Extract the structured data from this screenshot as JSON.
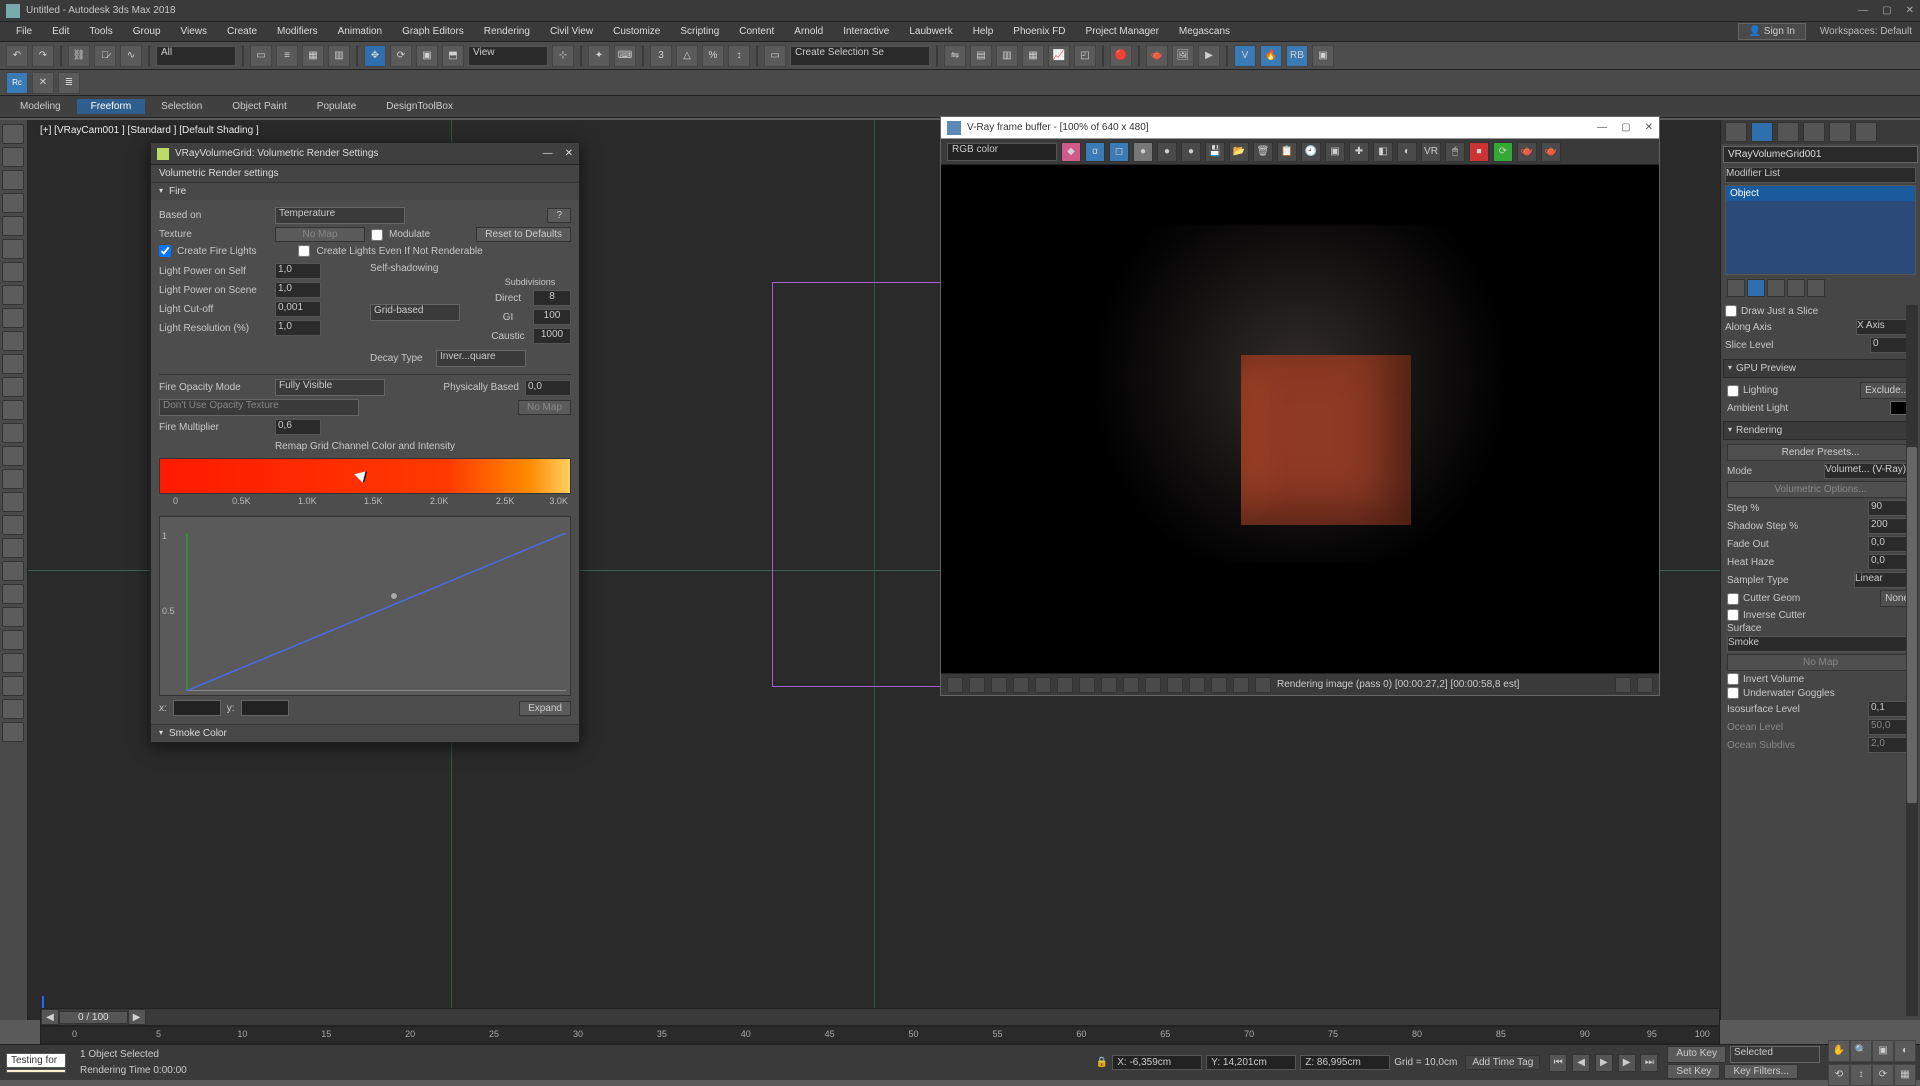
{
  "app": {
    "title": "Untitled - Autodesk 3ds Max 2018"
  },
  "menu": [
    "File",
    "Edit",
    "Tools",
    "Group",
    "Views",
    "Create",
    "Modifiers",
    "Animation",
    "Graph Editors",
    "Rendering",
    "Civil View",
    "Customize",
    "Scripting",
    "Content",
    "Arnold",
    "Interactive",
    "Laubwerk",
    "Help",
    "Phoenix FD",
    "Project Manager",
    "Megascans"
  ],
  "signin": "Sign In",
  "workspace_label": "Workspaces: Default",
  "toolbar_dropdowns": {
    "all_filter": "All",
    "view_mode": "View",
    "create_sel_set": "Create Selection Se"
  },
  "ribbon_tabs": [
    "Modeling",
    "Freeform",
    "Selection",
    "Object Paint",
    "Populate",
    "DesignToolBox"
  ],
  "viewport_label": "[+] [VRayCam001 ] [Standard ] [Default Shading ]",
  "command_panel": {
    "object_name": "VRayVolumeGrid001",
    "modifier_label": "Modifier List",
    "stack_item": "Object",
    "slice": {
      "draw_label": "Draw Just a Slice",
      "axis_label": "Along Axis",
      "axis_value": "X Axis",
      "level_label": "Slice Level",
      "level_value": "0"
    },
    "preview": {
      "header": "GPU Preview",
      "lighting_label": "Lighting",
      "exclude_btn": "Exclude...",
      "ambient_label": "Ambient Light"
    },
    "rendering": {
      "header": "Rendering",
      "presets_btn": "Render Presets...",
      "mode_label": "Mode",
      "mode_value": "Volumet... (V-Ray)",
      "vol_opts_btn": "Volumetric Options...",
      "step_label": "Step %",
      "step_value": "90",
      "shadow_label": "Shadow Step %",
      "shadow_value": "200",
      "fade_label": "Fade Out",
      "fade_value": "0,0",
      "haze_label": "Heat Haze",
      "haze_value": "0,0",
      "sampler_label": "Sampler Type",
      "sampler_value": "Linear",
      "cutter_label": "Cutter Geom",
      "cutter_value": "None",
      "inverse_cutter": "Inverse Cutter",
      "surface_label": "Surface",
      "surface_value": "Smoke",
      "nomap": "No Map",
      "invert_vol": "Invert Volume",
      "goggles": "Underwater Goggles",
      "iso_label": "Isosurface Level",
      "iso_value": "0,1",
      "ocean_level_label": "Ocean Level",
      "ocean_level_value": "50,0",
      "ocean_subdiv_label": "Ocean Subdivs",
      "ocean_subdiv_value": "2,0"
    }
  },
  "vol_dialog": {
    "title": "VRayVolumeGrid: Volumetric Render Settings",
    "subtitle": "Volumetric Render settings",
    "fire_header": "Fire",
    "based_on_label": "Based on",
    "based_on_value": "Temperature",
    "help_btn": "?",
    "texture_label": "Texture",
    "texture_btn": "No Map",
    "modulate_label": "Modulate",
    "reset_btn": "Reset to Defaults",
    "create_fire_lights": "Create Fire Lights",
    "create_lights_nonrender": "Create Lights Even If Not Renderable",
    "lp_self_label": "Light Power on Self",
    "lp_self_value": "1,0",
    "lp_scene_label": "Light Power on Scene",
    "lp_scene_value": "1,0",
    "light_cut_label": "Light Cut-off",
    "light_cut_value": "0,001",
    "light_res_label": "Light Resolution (%)",
    "light_res_value": "1,0",
    "self_shadow_label": "Self-shadowing",
    "self_shadow_value": "Grid-based",
    "decay_label": "Decay Type",
    "decay_value": "Inver...quare",
    "subdiv_header": "Subdivisions",
    "direct_label": "Direct",
    "direct_value": "8",
    "gi_label": "GI",
    "gi_value": "100",
    "caustic_label": "Caustic",
    "caustic_value": "1000",
    "opacity_mode_label": "Fire Opacity Mode",
    "opacity_mode_value": "Fully Visible",
    "phys_based_label": "Physically Based",
    "phys_based_value": "0,0",
    "use_opacity_tex": "Don't Use Opacity Texture",
    "nomap2": "No Map",
    "fire_mult_label": "Fire Multiplier",
    "fire_mult_value": "0,6",
    "remap_header": "Remap Grid Channel Color and Intensity",
    "grad_ticks": [
      "0",
      "0.5K",
      "1.0K",
      "1.5K",
      "2.0K",
      "2.5K",
      "3.0K"
    ],
    "y_ticks": [
      "1",
      "0.5"
    ],
    "x_label": "x:",
    "y_label": "y:",
    "expand_btn": "Expand",
    "smoke_header": "Smoke Color"
  },
  "vfb": {
    "title": "V-Ray frame buffer - [100% of 640 x 480]",
    "channel": "RGB color",
    "status_text": "Rendering image (pass 0) [00:00:27,2] [00:00:58,8 est]"
  },
  "timeline": {
    "frame_indicator": "0 / 100",
    "ticks": [
      0,
      5,
      10,
      15,
      20,
      25,
      30,
      35,
      40,
      45,
      50,
      55,
      60,
      65,
      70,
      75,
      80,
      85,
      90,
      95,
      100
    ]
  },
  "status": {
    "sel_info": "1 Object Selected",
    "render_time": "Rendering Time 0:00:00",
    "testing": "Testing for ",
    "coords": {
      "x": "X: -6,359cm",
      "y": "Y: 14,201cm",
      "z": "Z: 86,995cm",
      "grid": "Grid = 10,0cm"
    },
    "autokey": "Auto Key",
    "setkey": "Set Key",
    "selected": "Selected",
    "keyfilters": "Key Filters...",
    "add_time_tag": "Add Time Tag"
  },
  "chart_data": {
    "type": "line",
    "title": "Remap Grid Channel Color and Intensity",
    "x": [
      0,
      1666,
      3000
    ],
    "y": [
      0.0,
      0.55,
      1.0
    ],
    "xlim": [
      0,
      3000
    ],
    "ylim": [
      0,
      1
    ],
    "x_ticks": [
      0,
      500,
      1000,
      1500,
      2000,
      2500,
      3000
    ],
    "x_tick_labels": [
      "0",
      "0.5K",
      "1.0K",
      "1.5K",
      "2.0K",
      "2.5K",
      "3.0K"
    ],
    "y_ticks": [
      0.5,
      1.0
    ],
    "xlabel": "",
    "ylabel": "",
    "gradient_stops": [
      {
        "t": 0.0,
        "color": "#ff1a00"
      },
      {
        "t": 0.7,
        "color": "#ff3a00"
      },
      {
        "t": 0.9,
        "color": "#ff8a00"
      },
      {
        "t": 1.0,
        "color": "#ffd060"
      }
    ]
  }
}
